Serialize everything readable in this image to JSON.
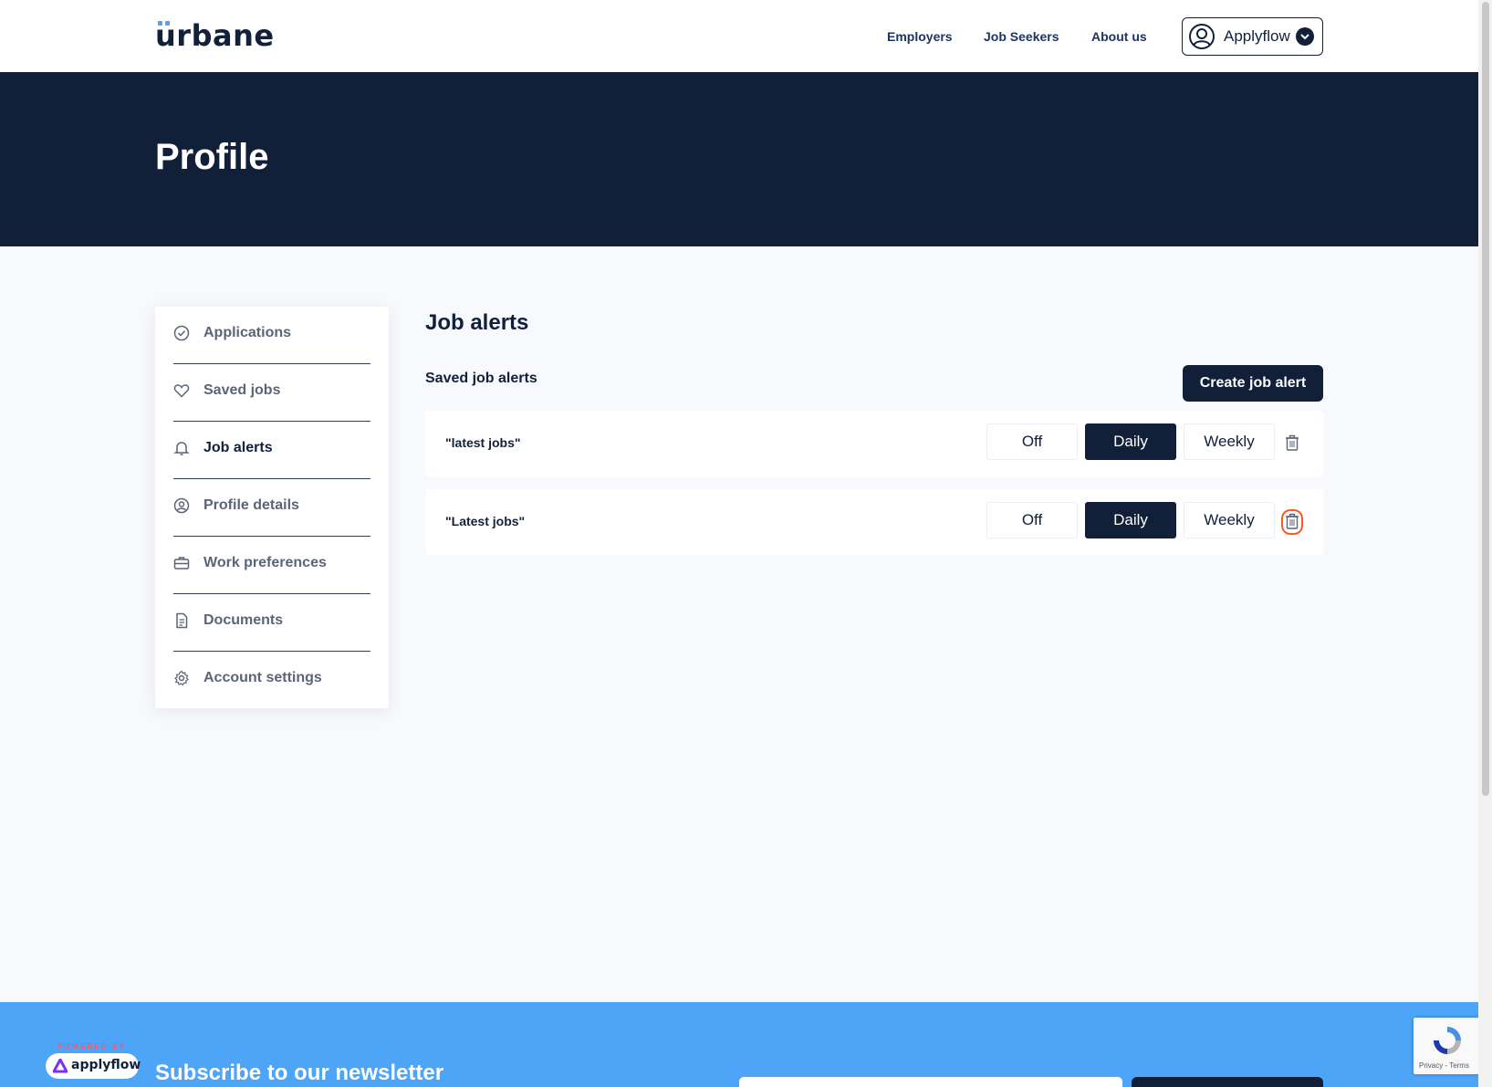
{
  "header": {
    "logo": "urbane",
    "nav": [
      "Employers",
      "Job Seekers",
      "About us"
    ],
    "account_label": "Applyflow"
  },
  "hero": {
    "title": "Profile"
  },
  "sidebar": {
    "items": [
      {
        "label": "Applications",
        "icon": "check-circle-icon",
        "active": false
      },
      {
        "label": "Saved jobs",
        "icon": "heart-icon",
        "active": false
      },
      {
        "label": "Job alerts",
        "icon": "bell-icon",
        "active": true
      },
      {
        "label": "Profile details",
        "icon": "user-circle-icon",
        "active": false
      },
      {
        "label": "Work preferences",
        "icon": "briefcase-icon",
        "active": false
      },
      {
        "label": "Documents",
        "icon": "document-icon",
        "active": false
      },
      {
        "label": "Account settings",
        "icon": "gear-icon",
        "active": false
      }
    ]
  },
  "main": {
    "title": "Job alerts",
    "subtitle": "Saved job alerts",
    "create_button": "Create job alert",
    "frequency_options": [
      "Off",
      "Daily",
      "Weekly"
    ],
    "alerts": [
      {
        "name": "\"latest jobs\"",
        "selected": "Daily"
      },
      {
        "name": "\"Latest jobs\"",
        "selected": "Daily"
      }
    ]
  },
  "footer": {
    "powered_by": "POWERED BY",
    "brand": "applyflow",
    "newsletter_title": "Subscribe to our newsletter",
    "recaptcha_text": "Privacy - Terms"
  },
  "colors": {
    "navy": "#111f38",
    "accent_blue": "#4ea4f7",
    "focus_orange": "#ff5a1f"
  }
}
